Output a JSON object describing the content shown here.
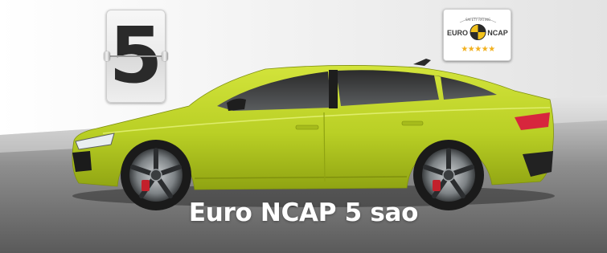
{
  "flip_card": {
    "digit": "5"
  },
  "badge": {
    "logo_text": "EURONCAP",
    "rating_text": "SAFETY RATING",
    "stars": "★★★★★",
    "star_count": 5
  },
  "caption": "Euro NCAP 5 sao",
  "colors": {
    "car_body": "#bcd42a",
    "tail_light": "#d7263d",
    "ground_dark": "#5f5f5f"
  }
}
